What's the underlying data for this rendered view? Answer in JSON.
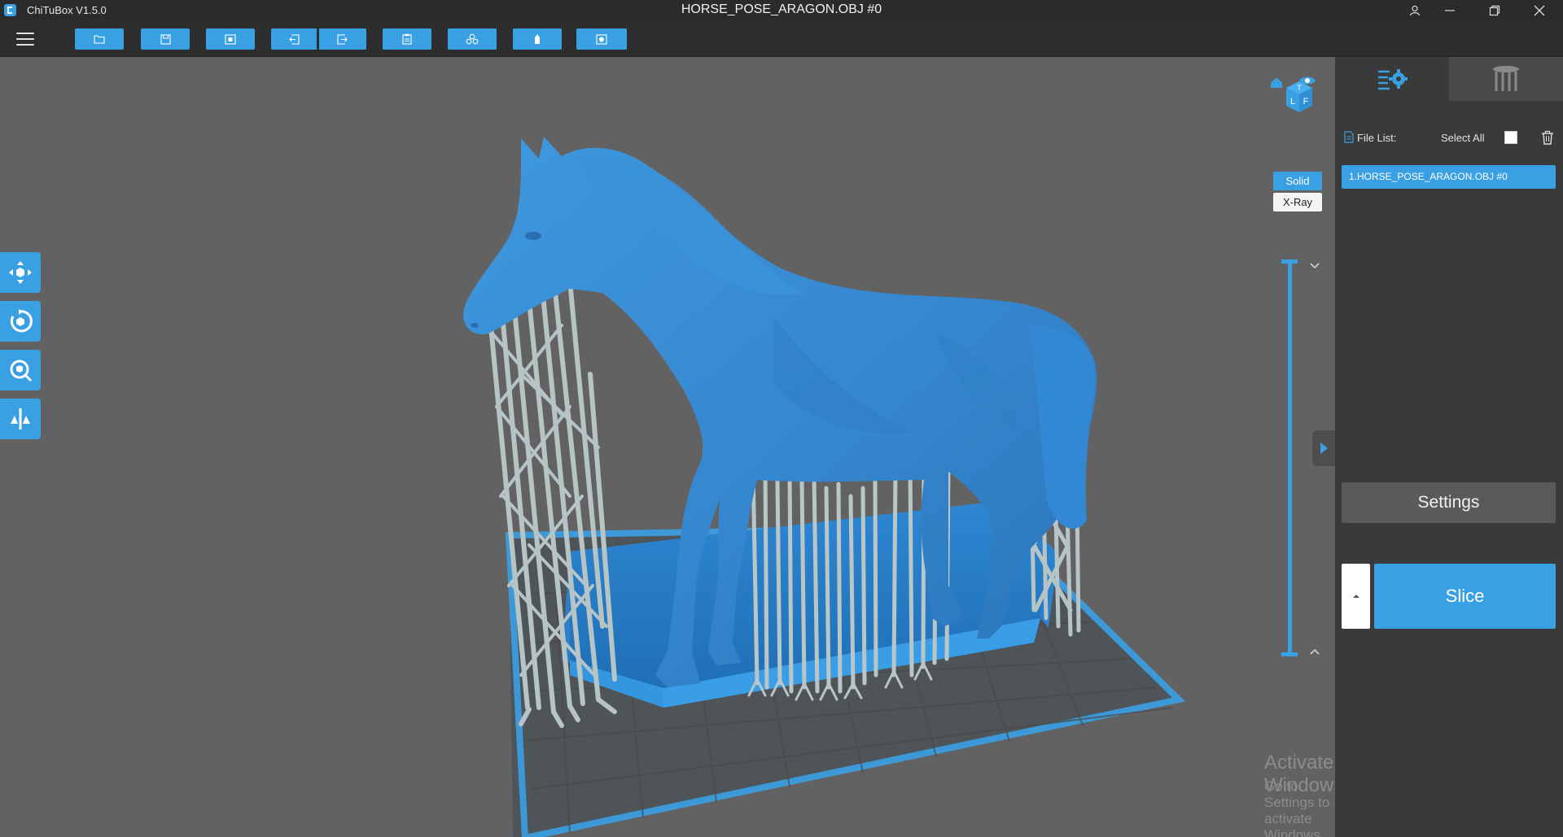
{
  "window": {
    "app_name": "ChiTuBox V1.5.0",
    "document_title": "HORSE_POSE_ARAGON.OBJ #0",
    "controls": [
      "account-icon",
      "minimize-icon",
      "restore-icon",
      "close-icon"
    ]
  },
  "toolbar": {
    "menu_icon": "hamburger-icon",
    "buttons": [
      "open-file-icon",
      "save-icon",
      "screenshot-icon",
      "undo-icon",
      "redo-icon",
      "clipboard-icon",
      "arrange-icon",
      "support-icon",
      "layout-icon"
    ]
  },
  "left_tools": [
    "move-icon",
    "rotate-icon",
    "scale-icon",
    "mirror-icon"
  ],
  "view_cube": {
    "letters": [
      "T",
      "L",
      "F"
    ]
  },
  "render_modes": {
    "solid": "Solid",
    "xray": "X-Ray",
    "active": "Solid"
  },
  "panel": {
    "tabs": [
      "model-settings-icon",
      "supports-icon"
    ],
    "file_list_label": "File List:",
    "select_all_label": "Select All",
    "files": [
      "1.HORSE_POSE_ARAGON.OBJ #0"
    ],
    "settings_label": "Settings",
    "slice_label": "Slice"
  },
  "watermark": {
    "line1": "Activate Windows",
    "line2": "Go to Settings to activate Windows."
  },
  "colors": {
    "accent": "#3aa0e4",
    "model": "#3d8fd6",
    "supports": "#b3c1c2"
  }
}
